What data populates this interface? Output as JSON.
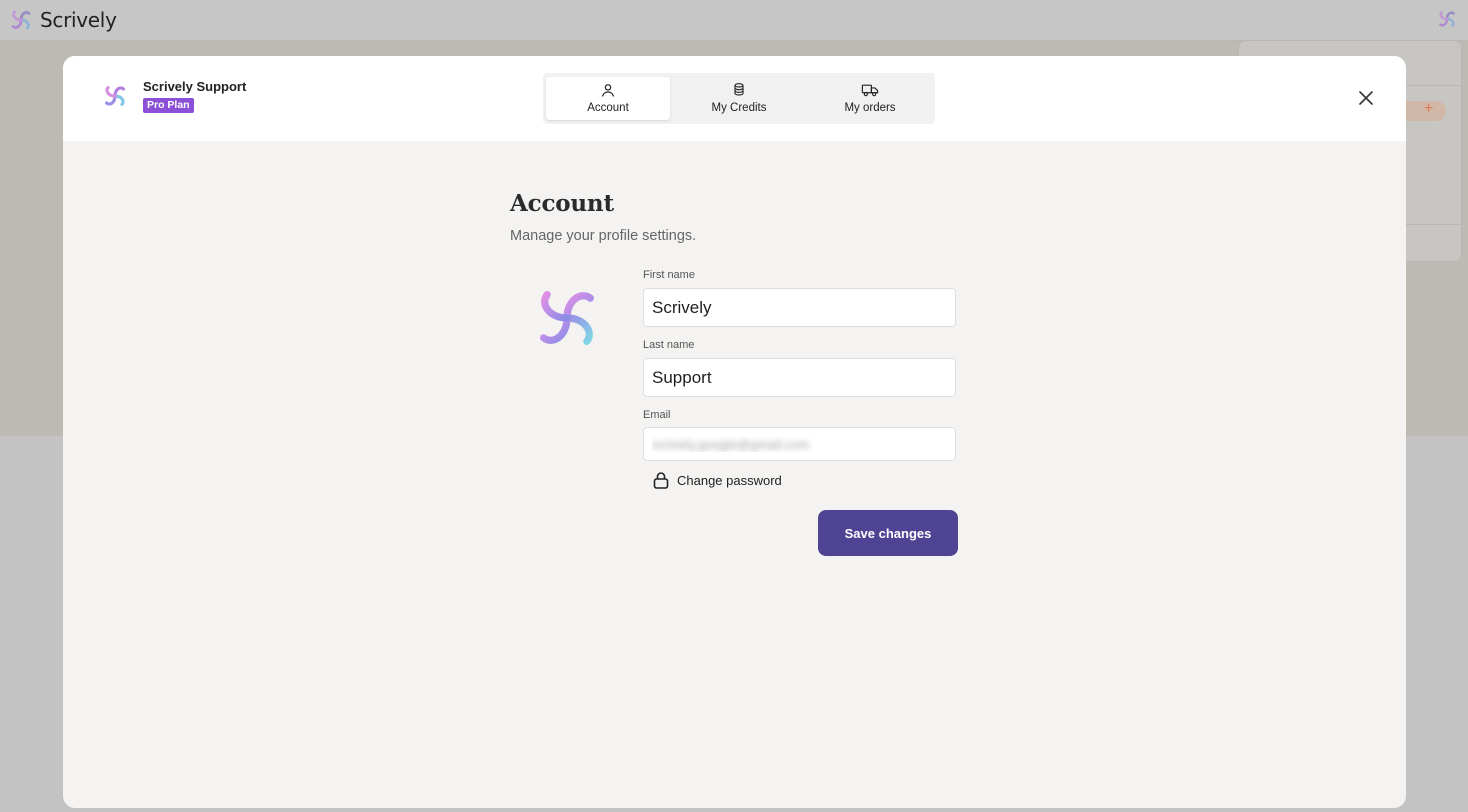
{
  "app": {
    "brand_name": "Scrively"
  },
  "modal": {
    "user": {
      "name": "Scrively Support",
      "plan": "Pro Plan"
    },
    "tabs": [
      {
        "label": "Account",
        "icon": "user-icon",
        "active": true
      },
      {
        "label": "My Credits",
        "icon": "coins-icon",
        "active": false
      },
      {
        "label": "My orders",
        "icon": "truck-icon",
        "active": false
      }
    ],
    "close_icon": "close-icon"
  },
  "account": {
    "title": "Account",
    "subtitle": "Manage your profile settings.",
    "first_name_label": "First name",
    "first_name_value": "Scrively",
    "last_name_label": "Last name",
    "last_name_value": "Support",
    "email_label": "Email",
    "email_value": "scrively.google@gmail.com",
    "change_password_label": "Change password",
    "save_label": "Save changes"
  },
  "colors": {
    "accent": "#4f4494",
    "badge": "#8b4fd8",
    "overlay": "#c4c4c4"
  }
}
